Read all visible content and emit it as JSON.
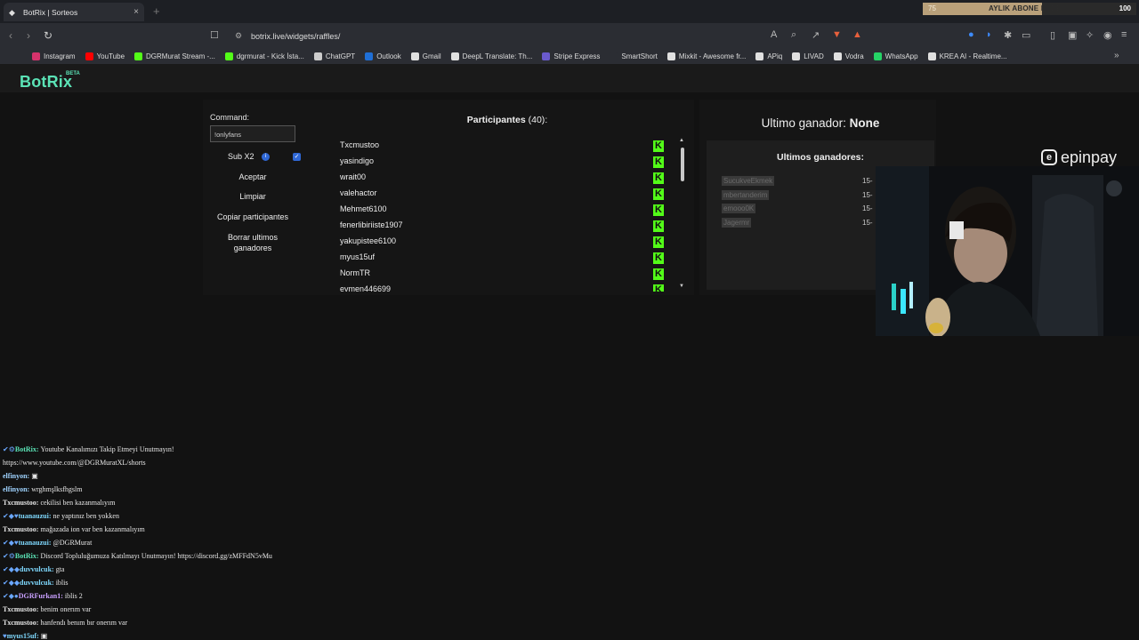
{
  "browser": {
    "tab_title": "BotRix | Sorteos",
    "tab_close": "×",
    "new_tab": "+",
    "url": "botrix.live/widgets/raffles/",
    "bookmarks": [
      "Instagram",
      "YouTube",
      "DGRMurat Stream -...",
      "dgrmurat - Kick İsta...",
      "ChatGPT",
      "Outlook",
      "Gmail",
      "DeepL Translate: Th...",
      "Stripe Express",
      "SmartShort",
      "Mixkit - Awesome fr...",
      "APiq",
      "LIVAD",
      "Vodra",
      "WhatsApp",
      "KREA AI - Realtime..."
    ],
    "bookmark_colors": [
      "#d6336c",
      "#ff0000",
      "#53fc18",
      "#53fc18",
      "#cccccc",
      "#1f6fd6",
      "#e0e0e0",
      "#e0e0e0",
      "#6a5acd",
      "#2b2d33",
      "#e0e0e0",
      "#e0e0e0",
      "#e0e0e0",
      "#e0e0e0",
      "#25d366",
      "#e0e0e0"
    ]
  },
  "overlay": {
    "sub_goal_current": "75",
    "sub_goal_label": "AYLIK ABONE HEDEFİ",
    "sub_goal_target": "100",
    "sub_goal_fraction": 0.75,
    "sponsor": "epinpay",
    "sponsor_icon": "e"
  },
  "app": {
    "brand": "BotRix",
    "beta": "BETA",
    "accent": "#5be3b6"
  },
  "controls": {
    "command_label": "Command:",
    "command_value": "!onlyfans",
    "sub_x2": "Sub X2",
    "sub_x2_checked": true,
    "accept": "Aceptar",
    "clear": "Limpiar",
    "copy": "Copiar participantes",
    "delete_winners_1": "Borrar ultimos",
    "delete_winners_2": "ganadores"
  },
  "participants": {
    "title": "Participantes",
    "count": "(40)",
    "colon": ":",
    "names": [
      "Txcmustoo",
      "yasindigo",
      "wrait00",
      "valehactor",
      "Mehmet6100",
      "fenerlibiriiste1907",
      "yakupistee6100",
      "myus15uf",
      "NormTR",
      "evmen446699"
    ]
  },
  "winners": {
    "last_label": "Ultimo ganador:",
    "last_value": "None",
    "list_title": "Ultimos ganadores:",
    "names": [
      "SucukveEkmek",
      "mbertanderim",
      "emooo0K",
      "Jagermr"
    ],
    "dates": [
      "15-",
      "15-",
      "15-",
      "15-"
    ]
  },
  "chat": [
    {
      "name": "BotRix:",
      "color": "#5be3b6",
      "badges": "✔⚙",
      "text": "Youtube Kanalımızı Takip Etmeyi Unutmayın!"
    },
    {
      "name": "",
      "color": "#e6e6e6",
      "badges": "",
      "text": "https://www.youtube.com/@DGRMuratXL/shorts"
    },
    {
      "name": "elfinyon:",
      "color": "#9fd3ff",
      "badges": "",
      "text": "▣"
    },
    {
      "name": "elfinyon:",
      "color": "#9fd3ff",
      "badges": "",
      "text": "wrghmşlksfhgslm"
    },
    {
      "name": "Txcmustoo:",
      "color": "#e6e6e6",
      "badges": "",
      "text": "cekilisi ben kazanmalıyım"
    },
    {
      "name": "tuanauzui:",
      "color": "#7fd9ff",
      "badges": "✔◆♥",
      "text": "ne yaptınız ben yokken"
    },
    {
      "name": "Txcmustoo:",
      "color": "#e6e6e6",
      "badges": "",
      "text": "mağazada ion var ben kazanmalıyım"
    },
    {
      "name": "tuanauzui:",
      "color": "#7fd9ff",
      "badges": "✔◆♥",
      "text": "@DGRMurat"
    },
    {
      "name": "BotRix:",
      "color": "#5be3b6",
      "badges": "✔⚙",
      "text": "Discord Topluluğumuza Katılmayı Unutmayın! https://discord.gg/zMFFdN5vMu"
    },
    {
      "name": "duvvulcuk:",
      "color": "#7fd9ff",
      "badges": "✔◆◆",
      "text": "gta"
    },
    {
      "name": "duvvulcuk:",
      "color": "#7fd9ff",
      "badges": "✔◆◆",
      "text": "iblis"
    },
    {
      "name": "DGRFurkan1:",
      "color": "#c9a0ff",
      "badges": "✔◆●",
      "text": "iblis 2"
    },
    {
      "name": "Txcmustoo:",
      "color": "#e6e6e6",
      "badges": "",
      "text": "benim onerım var"
    },
    {
      "name": "Txcmustoo:",
      "color": "#e6e6e6",
      "badges": "",
      "text": "hanfendı benım bır onerım var"
    },
    {
      "name": "myus15uf:",
      "color": "#7fd9ff",
      "badges": "♥",
      "text": "▣"
    }
  ]
}
